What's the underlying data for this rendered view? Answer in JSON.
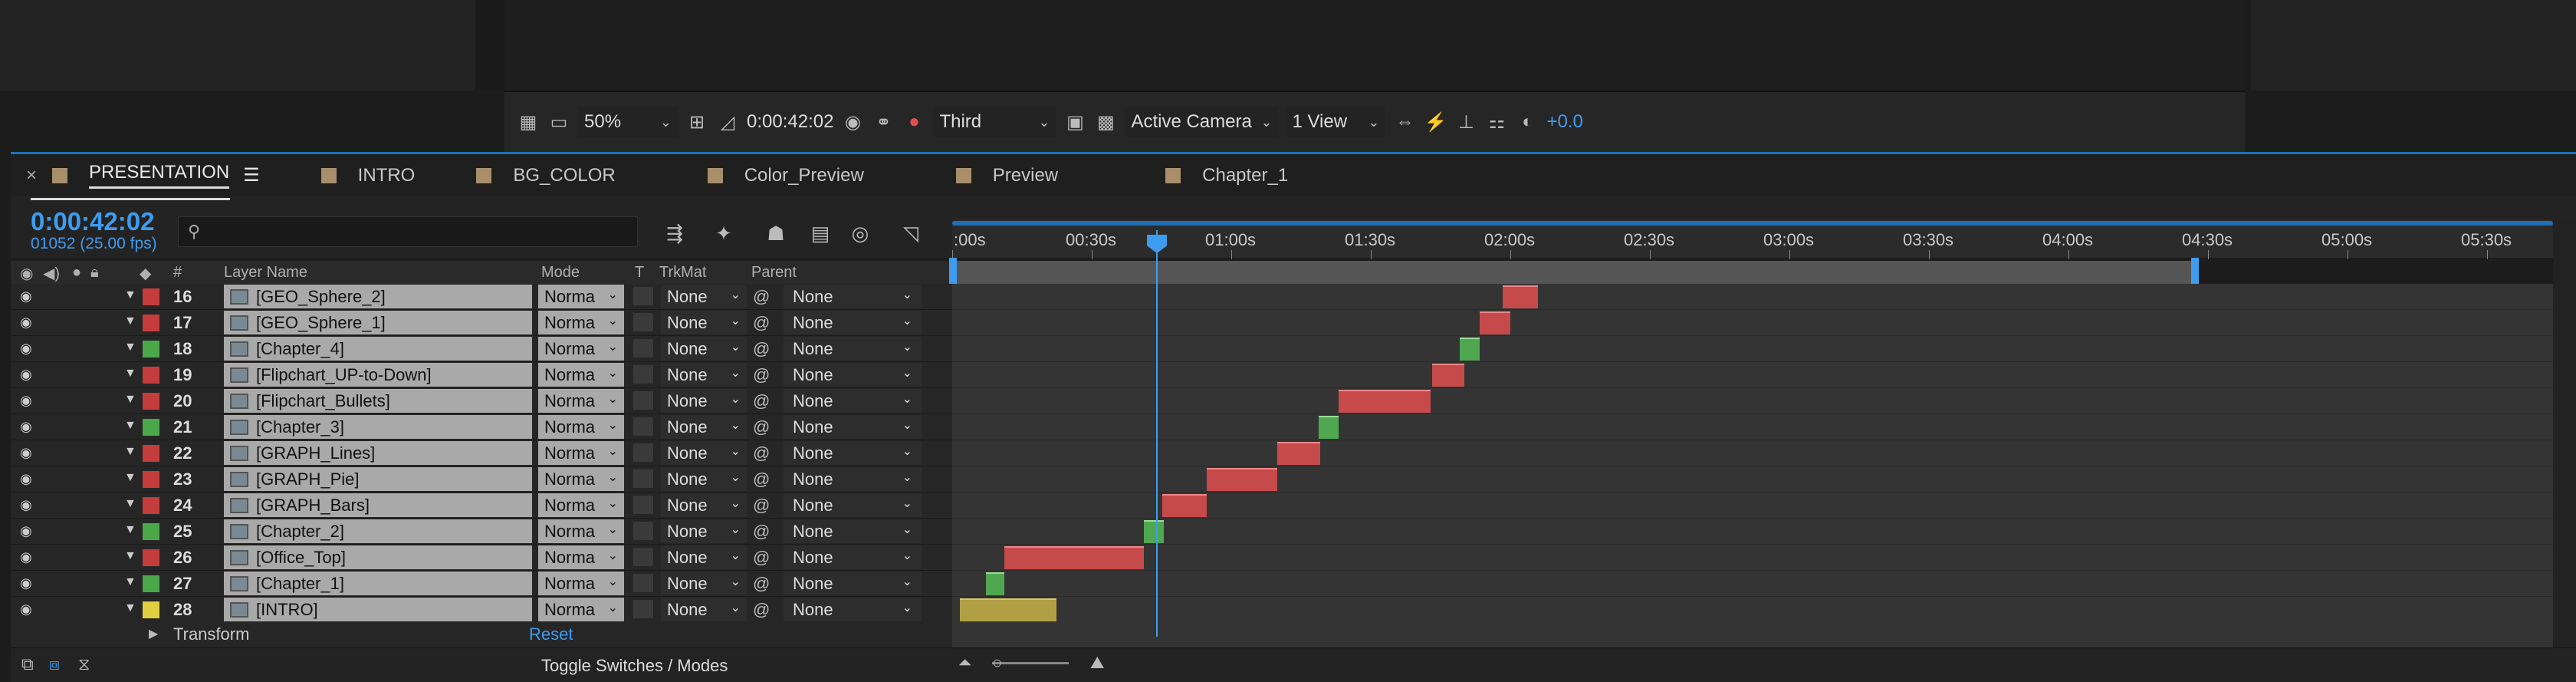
{
  "viewer_toolbar": {
    "zoom": "50%",
    "timecode": "0:00:42:02",
    "resolution": "Third",
    "camera": "Active Camera",
    "views": "1 View",
    "exposure": "+0.0"
  },
  "tabs": [
    {
      "label": "PRESENTATION",
      "active": true
    },
    {
      "label": "INTRO"
    },
    {
      "label": "BG_COLOR"
    },
    {
      "label": "Color_Preview"
    },
    {
      "label": "Preview"
    },
    {
      "label": "Chapter_1"
    }
  ],
  "timeline": {
    "current_time": "0:00:42:02",
    "frames_info": "01052 (25.00 fps)",
    "search_placeholder": "",
    "columns": {
      "num": "#",
      "layer_name": "Layer Name",
      "mode": "Mode",
      "t": "T",
      "trkmat": "TrkMat",
      "parent": "Parent"
    },
    "ruler_ticks": [
      ":00s",
      "00:30s",
      "01:00s",
      "01:30s",
      "02:00s",
      "02:30s",
      "03:00s",
      "03:30s",
      "04:00s",
      "04:30s",
      "05:00s",
      "05:30s"
    ],
    "layers": [
      {
        "num": "16",
        "name": "[GEO_Sphere_2]",
        "label_color": "#c43c3c",
        "mode": "Norma",
        "trkmat": "None",
        "parent": "None"
      },
      {
        "num": "17",
        "name": "[GEO_Sphere_1]",
        "label_color": "#c43c3c",
        "mode": "Norma",
        "trkmat": "None",
        "parent": "None"
      },
      {
        "num": "18",
        "name": "[Chapter_4]",
        "label_color": "#4aa84a",
        "mode": "Norma",
        "trkmat": "None",
        "parent": "None"
      },
      {
        "num": "19",
        "name": "[Flipchart_UP-to-Down]",
        "label_color": "#c43c3c",
        "mode": "Norma",
        "trkmat": "None",
        "parent": "None"
      },
      {
        "num": "20",
        "name": "[Flipchart_Bullets]",
        "label_color": "#c43c3c",
        "mode": "Norma",
        "trkmat": "None",
        "parent": "None"
      },
      {
        "num": "21",
        "name": "[Chapter_3]",
        "label_color": "#4aa84a",
        "mode": "Norma",
        "trkmat": "None",
        "parent": "None"
      },
      {
        "num": "22",
        "name": "[GRAPH_Lines]",
        "label_color": "#c43c3c",
        "mode": "Norma",
        "trkmat": "None",
        "parent": "None"
      },
      {
        "num": "23",
        "name": "[GRAPH_Pie]",
        "label_color": "#c43c3c",
        "mode": "Norma",
        "trkmat": "None",
        "parent": "None"
      },
      {
        "num": "24",
        "name": "[GRAPH_Bars]",
        "label_color": "#c43c3c",
        "mode": "Norma",
        "trkmat": "None",
        "parent": "None"
      },
      {
        "num": "25",
        "name": "[Chapter_2]",
        "label_color": "#4aa84a",
        "mode": "Norma",
        "trkmat": "None",
        "parent": "None"
      },
      {
        "num": "26",
        "name": "[Office_Top]",
        "label_color": "#c43c3c",
        "mode": "Norma",
        "trkmat": "None",
        "parent": "None"
      },
      {
        "num": "27",
        "name": "[Chapter_1]",
        "label_color": "#4aa84a",
        "mode": "Norma",
        "trkmat": "None",
        "parent": "None"
      },
      {
        "num": "28",
        "name": "[INTRO]",
        "label_color": "#e0d040",
        "mode": "Norma",
        "trkmat": "None",
        "parent": "None"
      }
    ],
    "transform_label": "Transform",
    "reset_label": "Reset",
    "toggle_label": "Toggle Switches / Modes"
  }
}
